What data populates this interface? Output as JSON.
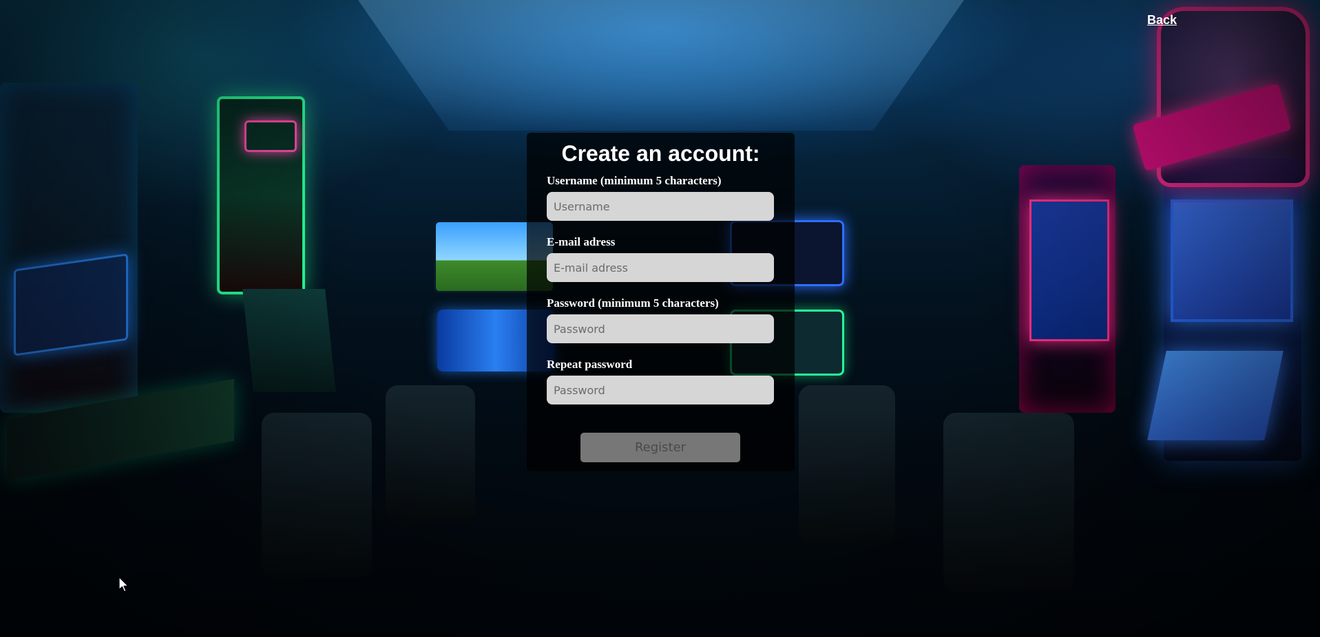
{
  "header": {
    "back_label": "Back"
  },
  "form": {
    "title": "Create an account:",
    "fields": [
      {
        "label": "Username (minimum 5 characters)",
        "placeholder": "Username",
        "value": ""
      },
      {
        "label": "E-mail adress",
        "placeholder": "E-mail adress",
        "value": ""
      },
      {
        "label": "Password (minimum 5 characters)",
        "placeholder": "Password",
        "value": ""
      },
      {
        "label": "Repeat password",
        "placeholder": "Password",
        "value": ""
      }
    ],
    "submit_label": "Register"
  },
  "icons": {
    "cursor": "mouse-pointer-icon"
  },
  "colors": {
    "panel_background": "rgba(0,0,0,0.72)",
    "input_background": "#d6d6d6",
    "button_background": "#777777",
    "text": "#ffffff"
  }
}
